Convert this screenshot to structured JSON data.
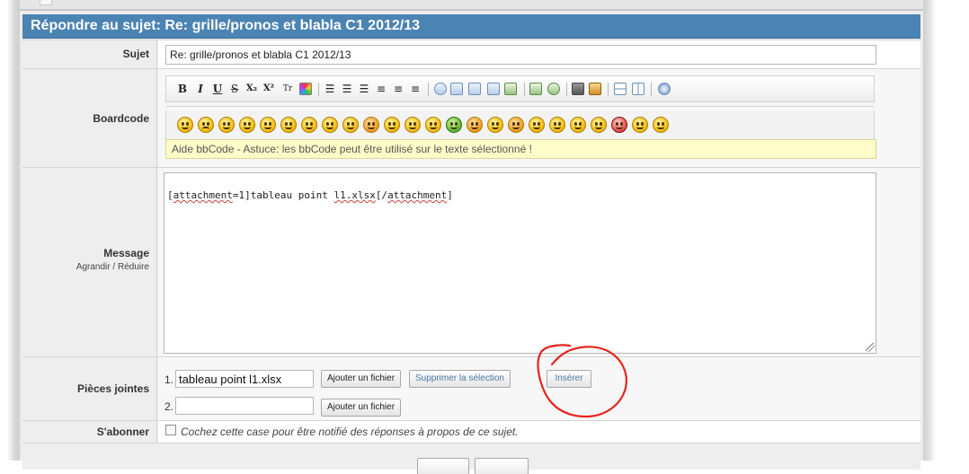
{
  "header": {
    "title": "Répondre au sujet: Re: grille/pronos et blabla C1 2012/13"
  },
  "subject": {
    "label": "Sujet",
    "value": "Re: grille/pronos et blabla C1 2012/13"
  },
  "boardcode": {
    "label": "Boardcode",
    "toolbar": {
      "bold": "B",
      "italic": "I",
      "underline": "U",
      "strike": "S",
      "subscript": "X₂",
      "superscript": "X²",
      "font": "Tr",
      "icons": [
        "color-icon",
        "list-bullet-icon",
        "list-number-icon",
        "list-icon",
        "align-left-icon",
        "align-center-icon",
        "align-right-icon",
        "quote-icon",
        "code-icon",
        "table-icon",
        "image-icon",
        "user-icon",
        "hyperlink-icon",
        "globe-icon",
        "video-icon",
        "flash-icon",
        "layout-split-h-icon",
        "layout-split-v-icon",
        "help-icon"
      ]
    },
    "smiley_count": 24,
    "help_text": "Aide bbCode - Astuce: les bbCode peut être utilisé sur le texte sélectionné !"
  },
  "message": {
    "label": "Message",
    "grow": "Agrandir",
    "separator": " / ",
    "shrink": "Réduire",
    "content_pre": "[",
    "content_tag": "attachment",
    "content_mid": "=1]tableau point ",
    "content_file": "l1.xlsx",
    "content_close_pre": "[/",
    "content_close_tag": "attachment",
    "content_close_post": "]"
  },
  "attachments": {
    "label": "Pièces jointes",
    "rows": [
      {
        "index": "1.",
        "value": "tableau point l1.xlsx"
      },
      {
        "index": "2.",
        "value": ""
      }
    ],
    "add_button": "Ajouter un fichier",
    "remove_button": "Supprimer la sélection",
    "insert_button": "Insérer"
  },
  "subscribe": {
    "label": "S'abonner",
    "checkbox_text": "Cochez cette case pour être notifié des réponses à propos de ce sujet."
  },
  "annotation": {
    "color": "#e8231c"
  },
  "colors": {
    "header": "#4b83b3",
    "help_bg": "#fffdc9",
    "link_blue": "#4a79a8"
  }
}
